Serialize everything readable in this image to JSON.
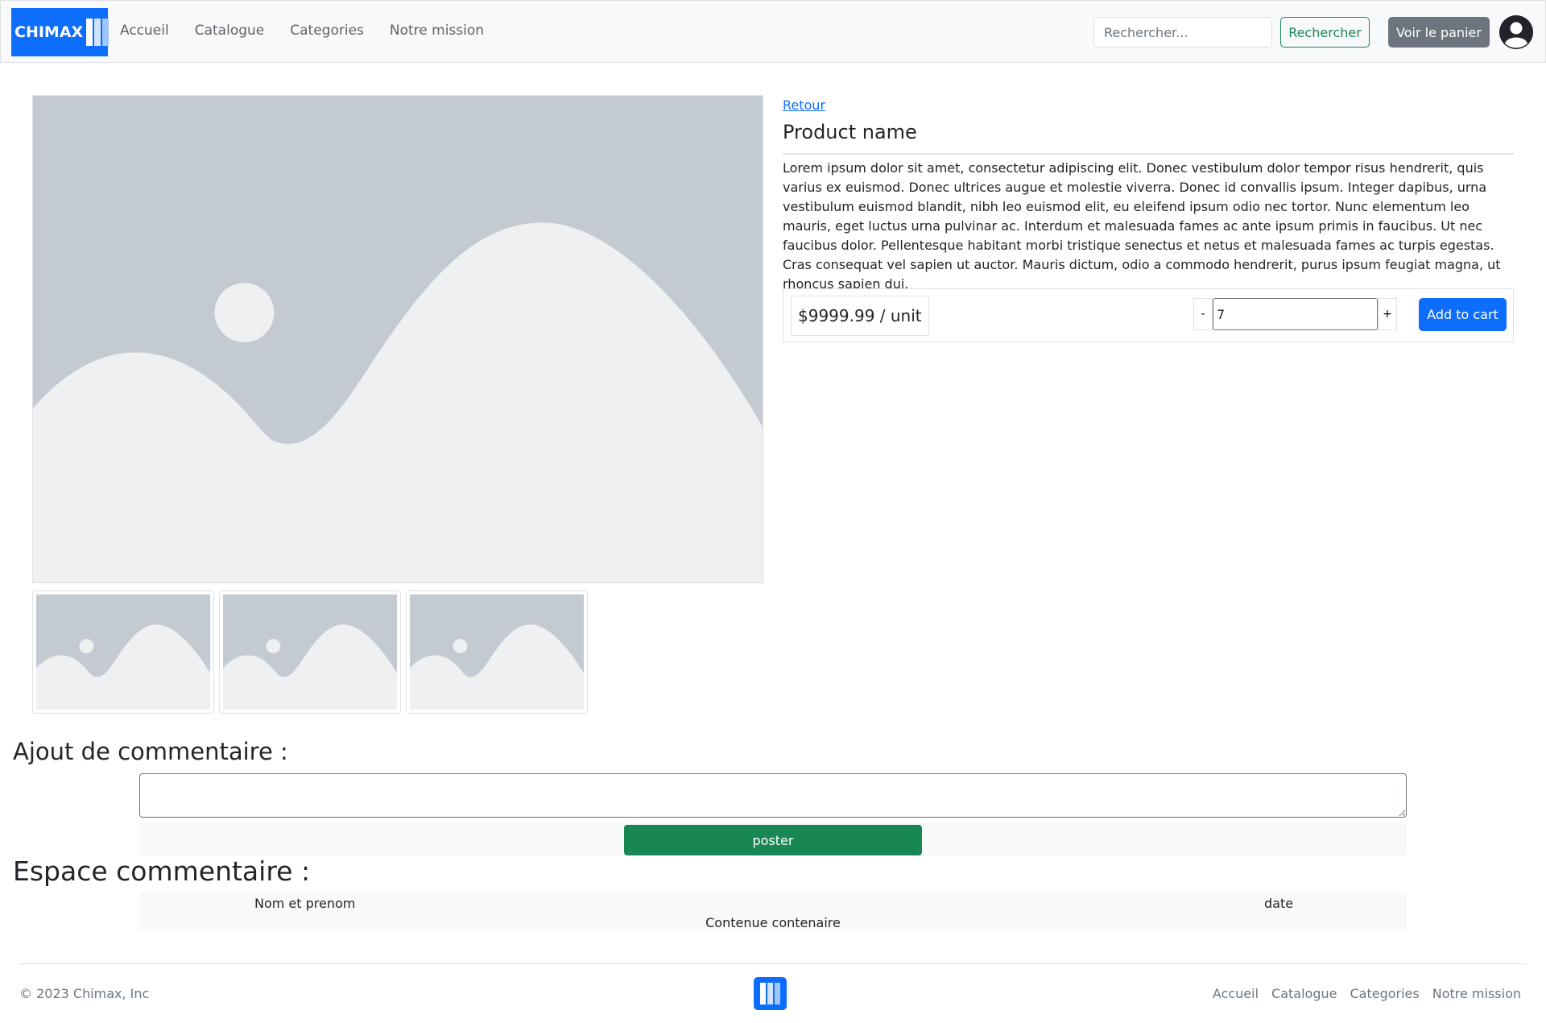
{
  "brand": {
    "name": "CHIMAX",
    "accent": "#0d6efd"
  },
  "nav": {
    "links": [
      "Accueil",
      "Catalogue",
      "Categories",
      "Notre mission"
    ]
  },
  "search": {
    "placeholder": "Rechercher...",
    "button_label": "Rechercher"
  },
  "cart_button_label": "Voir le panier",
  "user_icon": "user-circle-icon",
  "product": {
    "back_label": "Retour",
    "name": "Product name",
    "description": "Lorem ipsum dolor sit amet, consectetur adipiscing elit. Donec vestibulum dolor tempor risus hendrerit, quis varius ex euismod. Donec ultrices augue et molestie viverra. Donec id convallis ipsum. Integer dapibus, urna vestibulum euismod blandit, nibh leo euismod elit, eu eleifend ipsum odio nec tortor. Nunc elementum leo mauris, eget luctus urna pulvinar ac. Interdum et malesuada fames ac ante ipsum primis in faucibus. Ut nec faucibus dolor. Pellentesque habitant morbi tristique senectus et netus et malesuada fames ac turpis egestas. Cras consequat vel sapien ut auctor. Mauris dictum, odio a commodo hendrerit, purus ipsum feugiat magna, ut rhoncus sapien dui.",
    "price": "$9999.99 / unit",
    "quantity": "7",
    "minus_label": "-",
    "plus_label": "+",
    "add_to_cart_label": "Add to cart",
    "image_icon": "image-placeholder-icon",
    "thumbnail_count": 3
  },
  "comments": {
    "add_title": "Ajout de commentaire :",
    "textarea_value": "",
    "post_label": "poster",
    "space_title": "Espace commentaire :",
    "items": [
      {
        "author": "Nom et prenom",
        "date": "date",
        "content": "Contenue contenaire"
      }
    ]
  },
  "footer": {
    "copyright": "© 2023 Chimax, Inc",
    "links": [
      "Accueil",
      "Catalogue",
      "Categories",
      "Notre mission"
    ]
  },
  "colors": {
    "primary": "#0d6efd",
    "success": "#198754",
    "secondary": "#6c757d",
    "placeholder_bg": "#c3cad2",
    "placeholder_fg": "#eff0f2"
  }
}
